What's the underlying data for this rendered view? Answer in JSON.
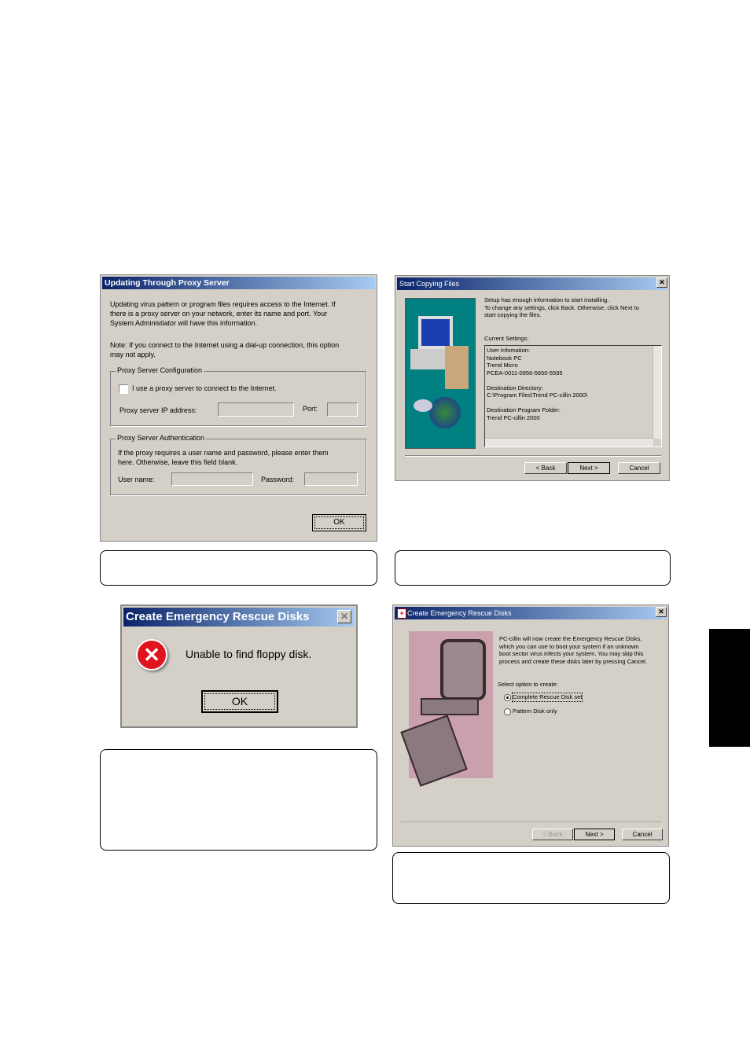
{
  "proxy": {
    "title": "Updating Through Proxy Server",
    "intro": "Updating virus pattern or program files requires access to the Internet. If\nthere is a proxy server on your network, enter its name and port. Your\nSystem Administiator will have this information.",
    "note": "Note: If you connect to the Internet using a dial-up connection, this option\nmay not apply.",
    "config_group": "Proxy Server Configuration",
    "checkbox_label": "I use a proxy server to connect to the Internet.",
    "checkbox_checked": false,
    "ip_label": "Proxy server IP address:",
    "port_label": "Port:",
    "auth_group": "Proxy Server Authentication",
    "auth_text": "If the proxy requires a user name and password, please enter them\nhere. Otherwise, leave this field blank.",
    "user_label": "User name:",
    "password_label": "Password:",
    "ok": "OK"
  },
  "copy": {
    "title": "Start Copying Files",
    "close": "✕",
    "intro": "Setup has enough information to start installing.\nTo change any settings, click Back. Otherwise, click Next to\nstart copying the files.",
    "current_settings": "Current Settings:",
    "settings_text": "User Infomation:\n        Notebook PC\n        Trend Micro\n        PCEA-0011-0856-5650-5595\n\nDestination Directory:\n         C:\\Program Files\\Trend PC-cillin 2000\\\n\nDestination Program Folder:\n         Trend PC-cillin 2000",
    "back": "< Back",
    "next": "Next >",
    "cancel": "Cancel"
  },
  "error": {
    "title": "Create Emergency Rescue Disks",
    "close": "✕",
    "message": "Unable to find floppy disk.",
    "ok": "OK",
    "icon_color": "#e0141e"
  },
  "rescue": {
    "title": "Create Emergency Rescue Disks",
    "close": "✕",
    "intro": "PC-cillin will now create the Emergency Rescue Disks,\nwhich you can use to boot your system if an unknown\nboot sector virus infects your system. You may skip this\nprocess and create these disks later by pressing Cancel.",
    "select_label": "Select option to create:",
    "options": [
      {
        "label": "Complete Rescue Disk set",
        "selected": true
      },
      {
        "label": "Pattern Disk only",
        "selected": false
      }
    ],
    "back": "< Back",
    "next": "Next >",
    "cancel": "Cancel"
  }
}
